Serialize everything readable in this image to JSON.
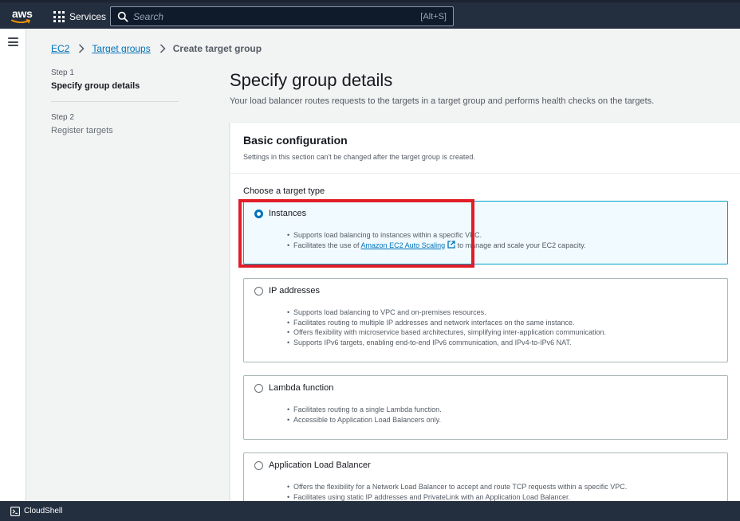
{
  "nav": {
    "logo_text": "aws",
    "services_label": "Services",
    "search_placeholder": "Search",
    "search_shortcut": "[Alt+S]"
  },
  "breadcrumb": {
    "items": [
      "EC2",
      "Target groups"
    ],
    "current": "Create target group"
  },
  "steps": [
    {
      "label": "Step 1",
      "title": "Specify group details"
    },
    {
      "label": "Step 2",
      "title": "Register targets"
    }
  ],
  "page": {
    "title": "Specify group details",
    "description": "Your load balancer routes requests to the targets in a target group and performs health checks on the targets."
  },
  "basic_config": {
    "title": "Basic configuration",
    "subtitle": "Settings in this section can't be changed after the target group is created.",
    "field_label": "Choose a target type",
    "options": [
      {
        "title": "Instances",
        "selected": true,
        "bullets": [
          "Supports load balancing to instances within a specific VPC.",
          {
            "before": "Facilitates the use of ",
            "link": "Amazon EC2 Auto Scaling",
            "after": " to manage and scale your EC2 capacity."
          }
        ]
      },
      {
        "title": "IP addresses",
        "selected": false,
        "bullets": [
          "Supports load balancing to VPC and on-premises resources.",
          "Facilitates routing to multiple IP addresses and network interfaces on the same instance.",
          "Offers flexibility with microservice based architectures, simplifying inter-application communication.",
          "Supports IPv6 targets, enabling end-to-end IPv6 communication, and IPv4-to-IPv6 NAT."
        ]
      },
      {
        "title": "Lambda function",
        "selected": false,
        "bullets": [
          "Facilitates routing to a single Lambda function.",
          "Accessible to Application Load Balancers only."
        ]
      },
      {
        "title": "Application Load Balancer",
        "selected": false,
        "bullets": [
          "Offers the flexibility for a Network Load Balancer to accept and route TCP requests within a specific VPC.",
          "Facilitates using static IP addresses and PrivateLink with an Application Load Balancer."
        ]
      }
    ]
  },
  "footer": {
    "cloudshell_label": "CloudShell"
  },
  "colors": {
    "nav_bg": "#232f3e",
    "link": "#0073bb",
    "selected_border": "#00a1c9",
    "highlight": "#e11d27"
  }
}
